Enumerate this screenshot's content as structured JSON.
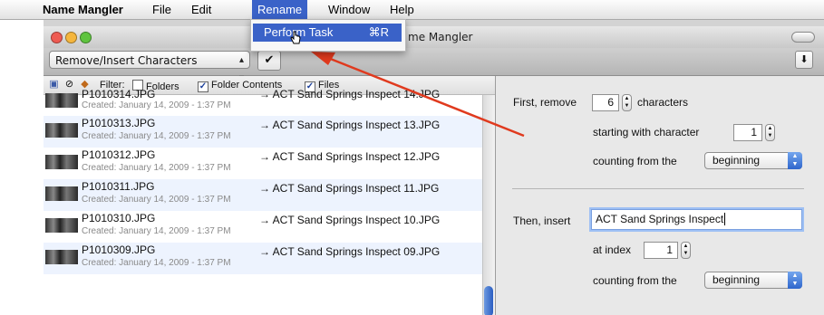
{
  "menubar": {
    "apple": "",
    "items": [
      "Name Mangler",
      "File",
      "Edit",
      "Rename",
      "Window",
      "Help"
    ],
    "active": "Rename"
  },
  "dropdown": {
    "item_label": "Perform Task",
    "shortcut": "⌘R"
  },
  "window": {
    "title": "me Mangler",
    "task_select": "Remove/Insert Characters",
    "run_button": "✔",
    "down_button": "⬇"
  },
  "filter": {
    "label": "Filter:",
    "options": [
      {
        "label": "Folders",
        "checked": false
      },
      {
        "label": "Folder Contents",
        "checked": true
      },
      {
        "label": "Files",
        "checked": true
      }
    ]
  },
  "files": [
    {
      "name": "P1010314.JPG",
      "created": "Created: January 14, 2009 - 1:37 PM",
      "new_name": "→ ACT Sand Springs Inspect 14.JPG"
    },
    {
      "name": "P1010313.JPG",
      "created": "Created: January 14, 2009 - 1:37 PM",
      "new_name": "→ ACT Sand Springs Inspect 13.JPG"
    },
    {
      "name": "P1010312.JPG",
      "created": "Created: January 14, 2009 - 1:37 PM",
      "new_name": "→ ACT Sand Springs Inspect 12.JPG"
    },
    {
      "name": "P1010311.JPG",
      "created": "Created: January 14, 2009 - 1:37 PM",
      "new_name": "→ ACT Sand Springs Inspect 11.JPG"
    },
    {
      "name": "P1010310.JPG",
      "created": "Created: January 14, 2009 - 1:37 PM",
      "new_name": "→ ACT Sand Springs Inspect 10.JPG"
    },
    {
      "name": "P1010309.JPG",
      "created": "Created: January 14, 2009 - 1:37 PM",
      "new_name": "→ ACT Sand Springs Inspect 09.JPG"
    }
  ],
  "remove": {
    "label_first": "First, remove",
    "count": "6",
    "label_characters": "characters",
    "label_starting": "starting with character",
    "start": "1",
    "label_counting": "counting from the",
    "counting": "beginning"
  },
  "insert": {
    "label_then": "Then, insert",
    "text": "ACT Sand Springs Inspect",
    "label_index": "at index",
    "index": "1",
    "label_counting": "counting from the",
    "counting": "beginning"
  },
  "colors": {
    "menu_highlight": "#3a62c8",
    "annotation_arrow": "#e03a1e"
  }
}
